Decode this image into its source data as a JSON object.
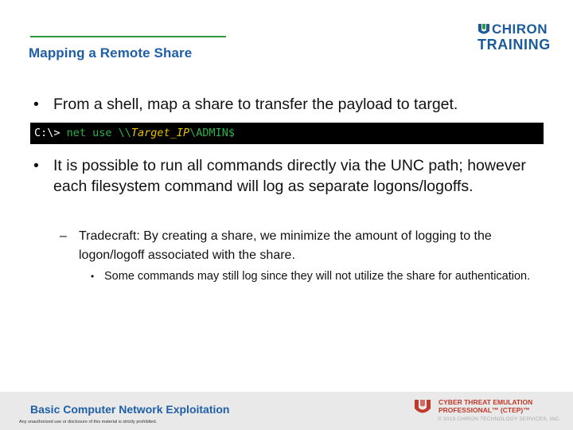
{
  "slide": {
    "title": "Mapping a Remote Share"
  },
  "logo": {
    "line1": "CHIRON",
    "line2": "TRAINING",
    "brand_color": "#1b5b99",
    "accent_color": "#2e9a3e"
  },
  "bullets": [
    {
      "text": "From a shell, map a share to transfer the payload to target."
    },
    {
      "text": "It is possible to run all commands directly via the UNC path; however each filesystem command will log as separate logons/logoffs."
    }
  ],
  "code": {
    "prompt": "C:\\>",
    "command": " net use \\\\",
    "target": "Target_IP",
    "suffix": "\\ADMIN$"
  },
  "sub_bullet": {
    "text": "Tradecraft: By creating a share, we minimize the amount of logging to the logon/logoff associated with the share."
  },
  "sub_sub_bullet": {
    "text": "Some commands may still log since they will not utilize the share for authentication."
  },
  "footer": {
    "course": "Basic Computer Network Exploitation",
    "notice": "Any unauthorized use or disclosure of this material is strictly prohibited.",
    "program_line1": "CYBER THREAT EMULATION",
    "program_line2": "PROFESSIONAL™ (CTEP)™",
    "copyright": "© 2019 CHIRON TECHNOLOGY SERVICES, INC."
  }
}
